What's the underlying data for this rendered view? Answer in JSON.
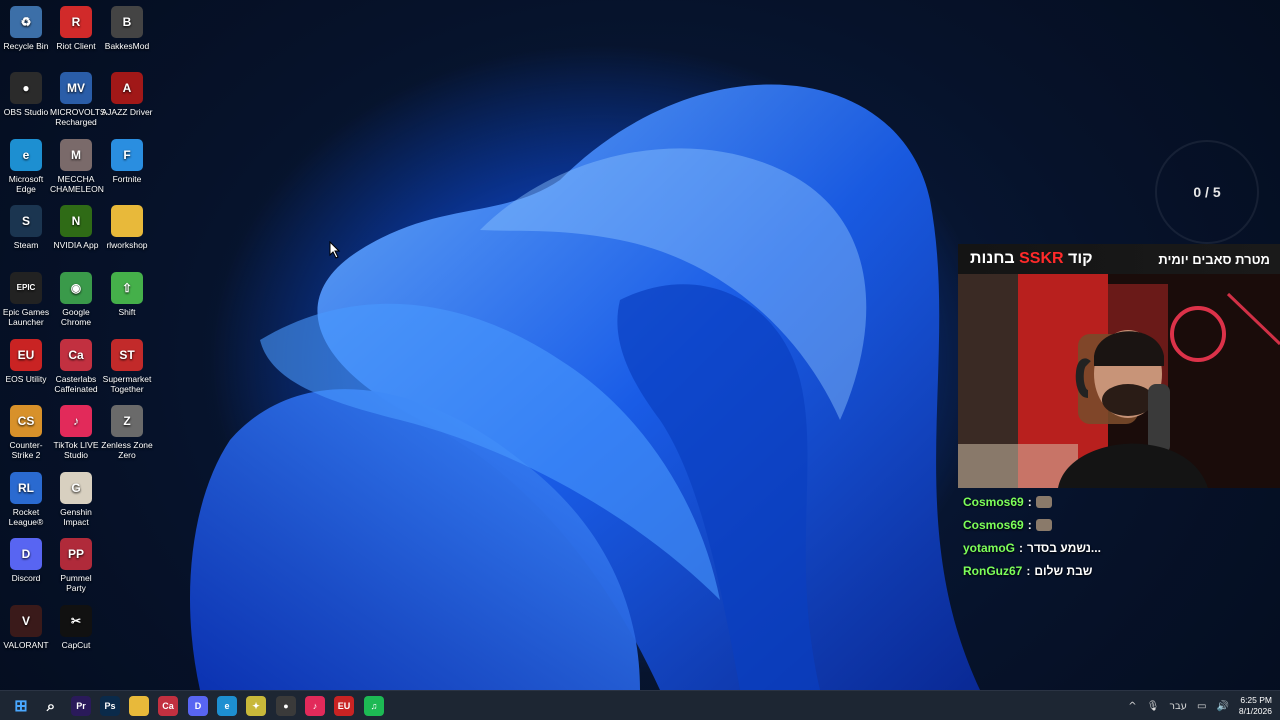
{
  "desktop": {
    "icons": [
      {
        "label": "Recycle Bin",
        "icon": "recycle-bin-icon",
        "color": "#3c6fa8",
        "glyph": "♻"
      },
      {
        "label": "Riot Client",
        "icon": "riot-client-icon",
        "color": "#d12a2a",
        "glyph": "R"
      },
      {
        "label": "BakkesMod",
        "icon": "bakkesmod-icon",
        "color": "#444444",
        "glyph": "B"
      },
      {
        "label": "OBS Studio",
        "icon": "obs-icon",
        "color": "#2b2b2b",
        "glyph": "●"
      },
      {
        "label": "MICROVOLTS Recharged",
        "icon": "microvolts-icon",
        "color": "#2a5da8",
        "glyph": "MV"
      },
      {
        "label": "AJAZZ Driver",
        "icon": "ajazz-icon",
        "color": "#a11818",
        "glyph": "A"
      },
      {
        "label": "Microsoft Edge",
        "icon": "edge-icon",
        "color": "#1d8fd1",
        "glyph": "e"
      },
      {
        "label": "MECCHA CHAMELEON",
        "icon": "meccha-chameleon-icon",
        "color": "#7a6a6a",
        "glyph": "M"
      },
      {
        "label": "Fortnite",
        "icon": "fortnite-icon",
        "color": "#2a8ee0",
        "glyph": "F"
      },
      {
        "label": "Steam",
        "icon": "steam-icon",
        "color": "#1b3550",
        "glyph": "S"
      },
      {
        "label": "NVIDIA App",
        "icon": "nvidia-icon",
        "color": "#2f6b16",
        "glyph": "N"
      },
      {
        "label": "rlworkshop",
        "icon": "folder-icon",
        "color": "#e8b93a",
        "glyph": ""
      },
      {
        "label": "Epic Games Launcher",
        "icon": "epic-games-icon",
        "color": "#222222",
        "glyph": "EPIC"
      },
      {
        "label": "Google Chrome",
        "icon": "chrome-icon",
        "color": "#3a9a4a",
        "glyph": "◉"
      },
      {
        "label": "Shift",
        "icon": "shift-icon",
        "color": "#45b04a",
        "glyph": "⇧"
      },
      {
        "label": "EOS Utility",
        "icon": "eos-utility-icon",
        "color": "#c92323",
        "glyph": "EU"
      },
      {
        "label": "Casterlabs Caffeinated",
        "icon": "casterlabs-icon",
        "color": "#c23040",
        "glyph": "Ca"
      },
      {
        "label": "Supermarket Together",
        "icon": "supermarket-together-icon",
        "color": "#c22a2a",
        "glyph": "ST"
      },
      {
        "label": "Counter-Strike 2",
        "icon": "counter-strike-icon",
        "color": "#d8912a",
        "glyph": "CS"
      },
      {
        "label": "TikTok LIVE Studio",
        "icon": "tiktok-live-icon",
        "color": "#e22a5a",
        "glyph": "♪"
      },
      {
        "label": "Zenless Zone Zero",
        "icon": "zenless-zone-zero-icon",
        "color": "#6a6a6a",
        "glyph": "Z"
      },
      {
        "label": "Rocket League®",
        "icon": "rocket-league-icon",
        "color": "#2a6ad0",
        "glyph": "RL"
      },
      {
        "label": "Genshin Impact",
        "icon": "genshin-impact-icon",
        "color": "#d8d0c0",
        "glyph": "G"
      },
      {
        "label": "Discord",
        "icon": "discord-icon",
        "color": "#5865f2",
        "glyph": "D"
      },
      {
        "label": "Pummel Party",
        "icon": "pummel-party-icon",
        "color": "#b02a3a",
        "glyph": "PP"
      },
      {
        "label": "VALORANT",
        "icon": "valorant-icon",
        "color": "#3a1a1a",
        "glyph": "V"
      },
      {
        "label": "CapCut",
        "icon": "capcut-icon",
        "color": "#111111",
        "glyph": "✂"
      }
    ]
  },
  "overlay": {
    "goal_counter": "0 / 5",
    "promo_text_prefix": "קוד",
    "promo_code": "SSKR",
    "promo_text_suffix": "בחנות",
    "goal_title": "מטרת סאבים יומית"
  },
  "chat": [
    {
      "user": "Cosmos69",
      "sep": " : ",
      "message": "",
      "emote": true
    },
    {
      "user": "Cosmos69",
      "sep": " : ",
      "message": "",
      "emote": true
    },
    {
      "user": "yotamoG",
      "sep": " : ",
      "message": "נשמע בסדר...",
      "emote": false
    },
    {
      "user": "RonGuz67",
      "sep": " : ",
      "message": "שבת שלום",
      "emote": false
    }
  ],
  "taskbar": {
    "apps": [
      {
        "name": "start-button",
        "glyph": "⊞",
        "color": "#2a8fe0"
      },
      {
        "name": "search-button",
        "glyph": "⌕",
        "color": "transparent"
      },
      {
        "name": "premiere-pro",
        "glyph": "Pr",
        "color": "#2a1a5a"
      },
      {
        "name": "photoshop",
        "glyph": "Ps",
        "color": "#0a2a4a"
      },
      {
        "name": "file-explorer",
        "glyph": "",
        "color": "#e8b93a"
      },
      {
        "name": "casterlabs",
        "glyph": "Ca",
        "color": "#c23040"
      },
      {
        "name": "discord",
        "glyph": "D",
        "color": "#5865f2"
      },
      {
        "name": "edge",
        "glyph": "e",
        "color": "#1d8fd1"
      },
      {
        "name": "sticky-app",
        "glyph": "✦",
        "color": "#c8b83a"
      },
      {
        "name": "obs",
        "glyph": "●",
        "color": "#3a3a3a"
      },
      {
        "name": "tiktok-live",
        "glyph": "♪",
        "color": "#e22a5a"
      },
      {
        "name": "eos-utility",
        "glyph": "EU",
        "color": "#c92323"
      },
      {
        "name": "spotify",
        "glyph": "♫",
        "color": "#1db954"
      }
    ],
    "tray": {
      "language": "עבר",
      "time": "6:25 PM",
      "date": "8/1/2026"
    }
  }
}
